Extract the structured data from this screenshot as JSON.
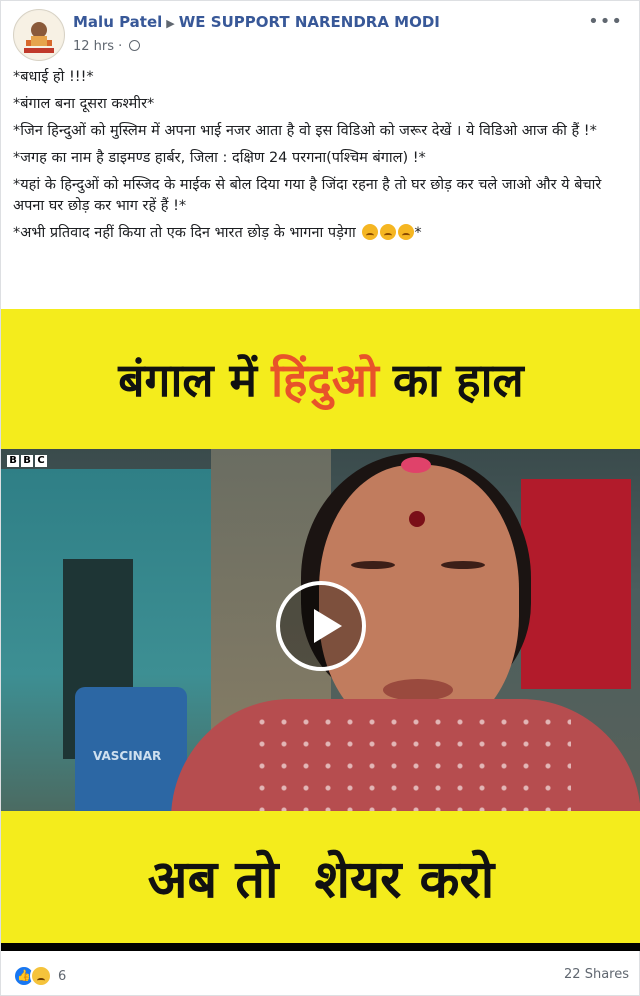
{
  "post": {
    "author": "Malu Patel",
    "group": "WE SUPPORT NARENDRA MODI",
    "timestamp": "12 hrs",
    "more_icon": "ellipsis-icon",
    "privacy_icon": "globe-icon"
  },
  "message": {
    "line1": "*बधाई हो !!!*",
    "line2": "*बंगाल बना दूसरा कश्मीर*",
    "line3": "*जिन हिन्दुओं को मुस्लिम में अपना भाई नजर आता है वो इस विडिओ को जरूर देखें । ये विडिओ आज की हैं !*",
    "line4": "*जगह का नाम है डाइमण्ड हार्बर, जिला : दक्षिण 24 परगना(पश्चिम बंगाल) !*",
    "line5": "*यहां के हिन्दुओं को मस्जिद के माईक से बोल दिया गया है जिंदा रहना है तो घर छोड़ कर चले जाओ और ये बेचारे अपना घर छोड़ कर भाग रहें हैं !*",
    "line6": "*अभी प्रतिवाद नहीं किया तो एक दिन भारत छोड़ के भागना पड़ेगा",
    "line6_end": "*"
  },
  "video": {
    "banner_top_part1": "बंगाल में",
    "banner_top_highlight": "हिंदुओ",
    "banner_top_part2": "का हाल",
    "watermark_letters": [
      "B",
      "B",
      "C"
    ],
    "barrel_text": "VASCINAR",
    "banner_bottom": "अब तो  शेयर करो",
    "play_icon": "play-icon"
  },
  "footer": {
    "reaction_count": "6",
    "shares": "22 Shares"
  },
  "colors": {
    "banner_yellow": "#f4ec1c",
    "highlight_orange": "#e8532a",
    "link_blue": "#385898"
  }
}
